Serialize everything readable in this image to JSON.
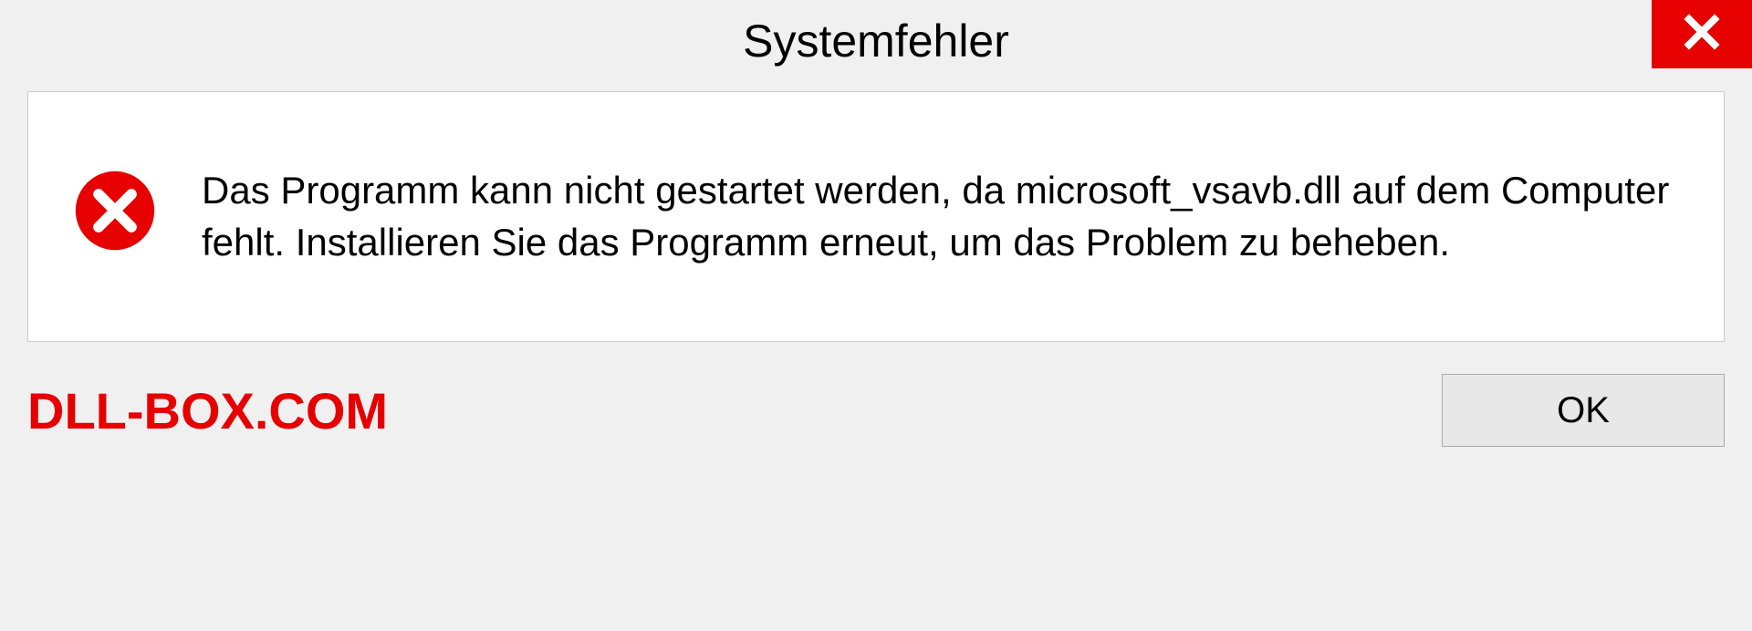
{
  "titlebar": {
    "title": "Systemfehler"
  },
  "content": {
    "message": "Das Programm kann nicht gestartet werden, da microsoft_vsavb.dll auf dem Computer fehlt. Installieren Sie das Programm erneut, um das Problem zu beheben."
  },
  "footer": {
    "watermark": "DLL-BOX.COM",
    "ok_label": "OK"
  }
}
